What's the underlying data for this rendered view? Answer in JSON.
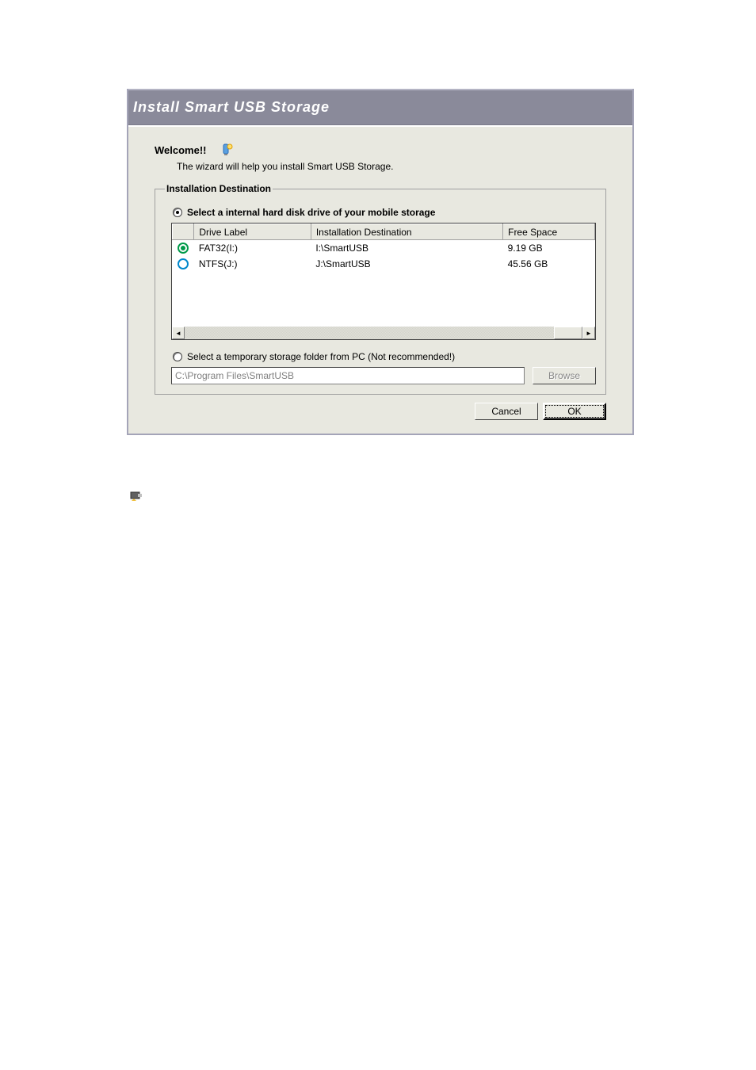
{
  "title": "Install Smart USB Storage",
  "welcome": "Welcome!!",
  "subtitle": "The wizard will help you install Smart USB Storage.",
  "groupbox_title": "Installation Destination",
  "option1_label": "Select a internal hard disk drive of your mobile storage",
  "option2_label": "Select a temporary storage folder from PC (Not recommended!)",
  "columns": {
    "icon": "",
    "label": "Drive Label",
    "dest": "Installation Destination",
    "free": "Free Space"
  },
  "drives": [
    {
      "selected": true,
      "label": "FAT32(I:)",
      "dest": "I:\\SmartUSB",
      "free": "9.19 GB"
    },
    {
      "selected": false,
      "label": "NTFS(J:)",
      "dest": "J:\\SmartUSB",
      "free": "45.56 GB"
    }
  ],
  "path_value": "C:\\Program Files\\SmartUSB",
  "buttons": {
    "browse": "Browse",
    "cancel": "Cancel",
    "ok": "OK"
  }
}
